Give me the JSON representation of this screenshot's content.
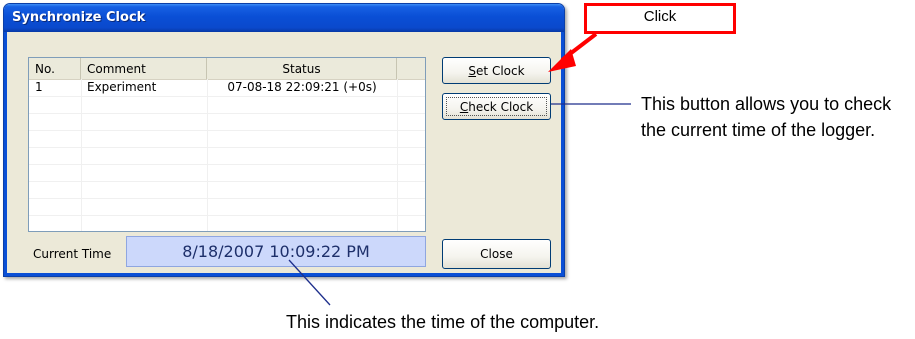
{
  "window": {
    "title": "Synchronize Clock"
  },
  "list": {
    "columns": [
      "No.",
      "Comment",
      "Status"
    ],
    "rows": [
      {
        "no": "1",
        "comment": "Experiment",
        "status": "07-08-18 22:09:21 (+0s)"
      }
    ]
  },
  "buttons": {
    "set_clock_prefix": "",
    "set_clock_mnemonic": "S",
    "set_clock_rest": "et Clock",
    "check_clock_mnemonic": "C",
    "check_clock_rest": "heck Clock",
    "close": "Close"
  },
  "current_time": {
    "label": "Current Time",
    "value": "8/18/2007 10:09:22 PM"
  },
  "annotations": {
    "click_label": "Click",
    "check_clock_note": "This button allows you to check the current time of the logger.",
    "time_note": "This indicates the time of the computer."
  },
  "colors": {
    "titlebar": "#0a4fd6",
    "dialog_bg": "#ece9d8",
    "time_display_bg": "#ccd8fb",
    "annotation_red": "#ff0000",
    "leader_line": "#1e2f8c"
  }
}
